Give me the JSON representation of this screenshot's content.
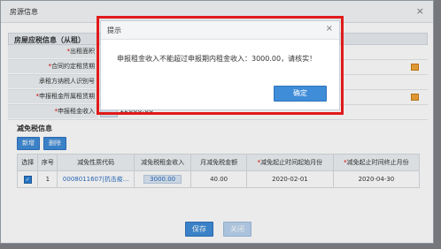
{
  "window": {
    "title": "房源信息",
    "close_glyph": "×"
  },
  "section": {
    "title": "房屋应税信息（从租）"
  },
  "form": {
    "rows": [
      {
        "label": "出租面积",
        "required": true,
        "value": ""
      },
      {
        "label": "合同约定租赁期",
        "required": true,
        "value": ""
      },
      {
        "label": "承租方纳税人识别号",
        "required": false,
        "value": ""
      },
      {
        "label": "申报租金所属租赁期",
        "required": true,
        "value": ""
      },
      {
        "label": "申报租金收入",
        "required": true,
        "value": "12000.00"
      }
    ]
  },
  "relief": {
    "title": "减免税信息",
    "add_label": "新增",
    "delete_label": "删除",
    "columns": [
      "选择",
      "序号",
      "减免性质代码",
      "减免税租金收入",
      "月减免税金额",
      "减免起止时间起始月份",
      "减免起止时间终止月份"
    ],
    "rows": [
      {
        "checked": true,
        "index": "1",
        "code": "0008011607|抗击疫...",
        "income": "3000.00",
        "monthly": "40.00",
        "start": "2020-02-01",
        "end": "2020-04-30"
      }
    ]
  },
  "buttons": {
    "save": "保存",
    "close": "关闭"
  },
  "dialog": {
    "title": "提示",
    "close_glyph": "×",
    "message": "申报租金收入不能超过申报期内租金收入：3000.00，请核实！",
    "ok_label": "确定"
  },
  "colors": {
    "accent": "#3f8cd8",
    "highlight": "#e11a1a",
    "required": "#dd0000",
    "calendar": "#f0a53a"
  }
}
